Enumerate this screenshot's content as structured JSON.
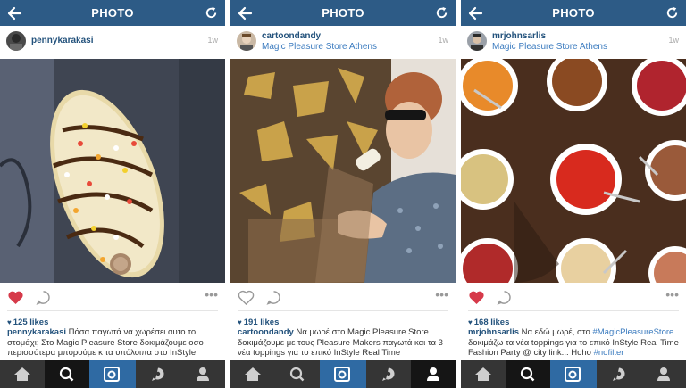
{
  "colors": {
    "topbar": "#2d5b86",
    "username": "#23527c",
    "link": "#3b7bbf",
    "tabbar": "#353535",
    "tab_active": "#2f6aa3",
    "liked_heart": "#d63a4a"
  },
  "posts": [
    {
      "header_title": "PHOTO",
      "username": "pennykarakasi",
      "location": "",
      "time": "1w",
      "liked": true,
      "likes": "125 likes",
      "caption_user": "pennykarakasi",
      "caption_text": " Πόσα παγωτά να χωρέσει αυτο το στομάχι; Στο Magic Pleasure Store δοκιμάζουμε οσο περισσότερα μπορούμε κ τα υπόλοιπα στο InStyle",
      "photo_subject": "ice-cream-bar-with-toppings",
      "active_tab": "search"
    },
    {
      "header_title": "PHOTO",
      "username": "cartoondandy",
      "location": "Magic Pleasure Store Athens",
      "time": "1w",
      "liked": false,
      "likes": "191 likes",
      "caption_user": "cartoondandy",
      "caption_text": " Να μωρέ στο Magic Pleasure Store δοκιμάζουμε με τους Pleasure Makers παγωτά και τα 3 νέα toppings για το επικό InStyle Real Time",
      "photo_subject": "man-eating-ice-cream",
      "active_tab": "profile"
    },
    {
      "header_title": "PHOTO",
      "username": "mrjohnsarlis",
      "location": "Magic Pleasure Store Athens",
      "time": "1w",
      "liked": true,
      "likes": "168 likes",
      "caption_user": "mrjohnsarlis",
      "caption_text": " Να εδώ μωρέ, στο ",
      "caption_tag1": "#MagicPleasureStore",
      "caption_text2": " δοκιμάζω τα νέα toppings για το επικό InStyle Real Time Fashion Party @ city link... Hoho ",
      "caption_tag2": "#nofilter",
      "photo_subject": "bowls-of-toppings",
      "active_tab": "search"
    }
  ],
  "tabs": [
    "home-icon",
    "search-icon",
    "camera-icon",
    "activity-icon",
    "profile-icon"
  ]
}
